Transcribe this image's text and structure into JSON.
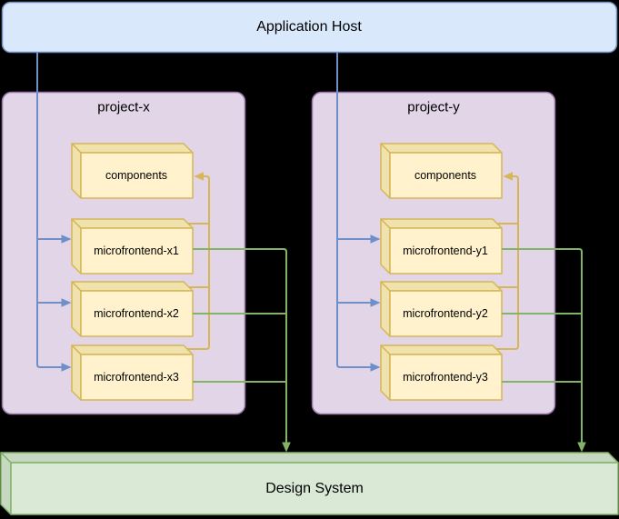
{
  "app_host": {
    "label": "Application Host"
  },
  "containers": [
    {
      "label": "project-x",
      "nodes": [
        {
          "label": "components"
        },
        {
          "label": "microfrontend-x1"
        },
        {
          "label": "microfrontend-x2"
        },
        {
          "label": "microfrontend-x3"
        }
      ]
    },
    {
      "label": "project-y",
      "nodes": [
        {
          "label": "components"
        },
        {
          "label": "microfrontend-y1"
        },
        {
          "label": "microfrontend-y2"
        },
        {
          "label": "microfrontend-y3"
        }
      ]
    }
  ],
  "design_system": {
    "label": "Design System"
  },
  "colors": {
    "background": "#000000",
    "app_host_fill": "#dae8fc",
    "app_host_stroke": "#6c8ebf",
    "container_fill": "#e1d5e7",
    "container_stroke": "#9673a6",
    "cube_front_fill": "#fff2cc",
    "cube_shade_fill": "#f0e2ad",
    "cube_stroke": "#d6b656",
    "design_front_fill": "#d9e9d6",
    "design_shade_fill": "#c7d8c2",
    "design_stroke": "#82b366",
    "edge_blue": "#6e8fc8",
    "edge_yellow": "#d6b656",
    "edge_green": "#82b366",
    "text_color": "#000000"
  }
}
